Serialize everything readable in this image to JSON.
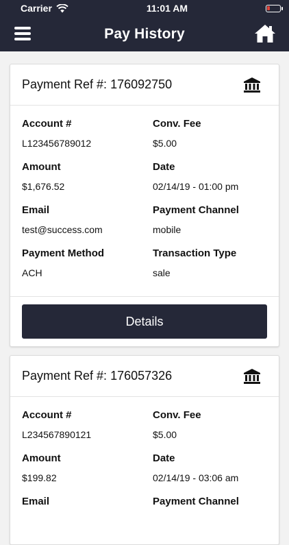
{
  "status_bar": {
    "carrier": "Carrier",
    "time": "11:01 AM"
  },
  "header": {
    "title": "Pay History"
  },
  "labels": {
    "payment_ref": "Payment Ref #:",
    "account": "Account #",
    "conv_fee": "Conv. Fee",
    "amount": "Amount",
    "date": "Date",
    "email": "Email",
    "payment_channel": "Payment Channel",
    "payment_method": "Payment Method",
    "transaction_type": "Transaction Type",
    "details_button": "Details"
  },
  "payments": [
    {
      "ref": "176092750",
      "account": "L123456789012",
      "conv_fee": "$5.00",
      "amount": "$1,676.52",
      "date": "02/14/19 - 01:00 pm",
      "email": "test@success.com",
      "payment_channel": "mobile",
      "payment_method": "ACH",
      "transaction_type": "sale"
    },
    {
      "ref": "176057326",
      "account": "L234567890121",
      "conv_fee": "$5.00",
      "amount": "$199.82",
      "date": "02/14/19 - 03:06 am",
      "email": "",
      "payment_channel": "",
      "payment_method": "",
      "transaction_type": ""
    }
  ],
  "icons": {
    "menu": "hamburger-menu-icon",
    "home": "home-icon",
    "bank": "bank-icon"
  }
}
